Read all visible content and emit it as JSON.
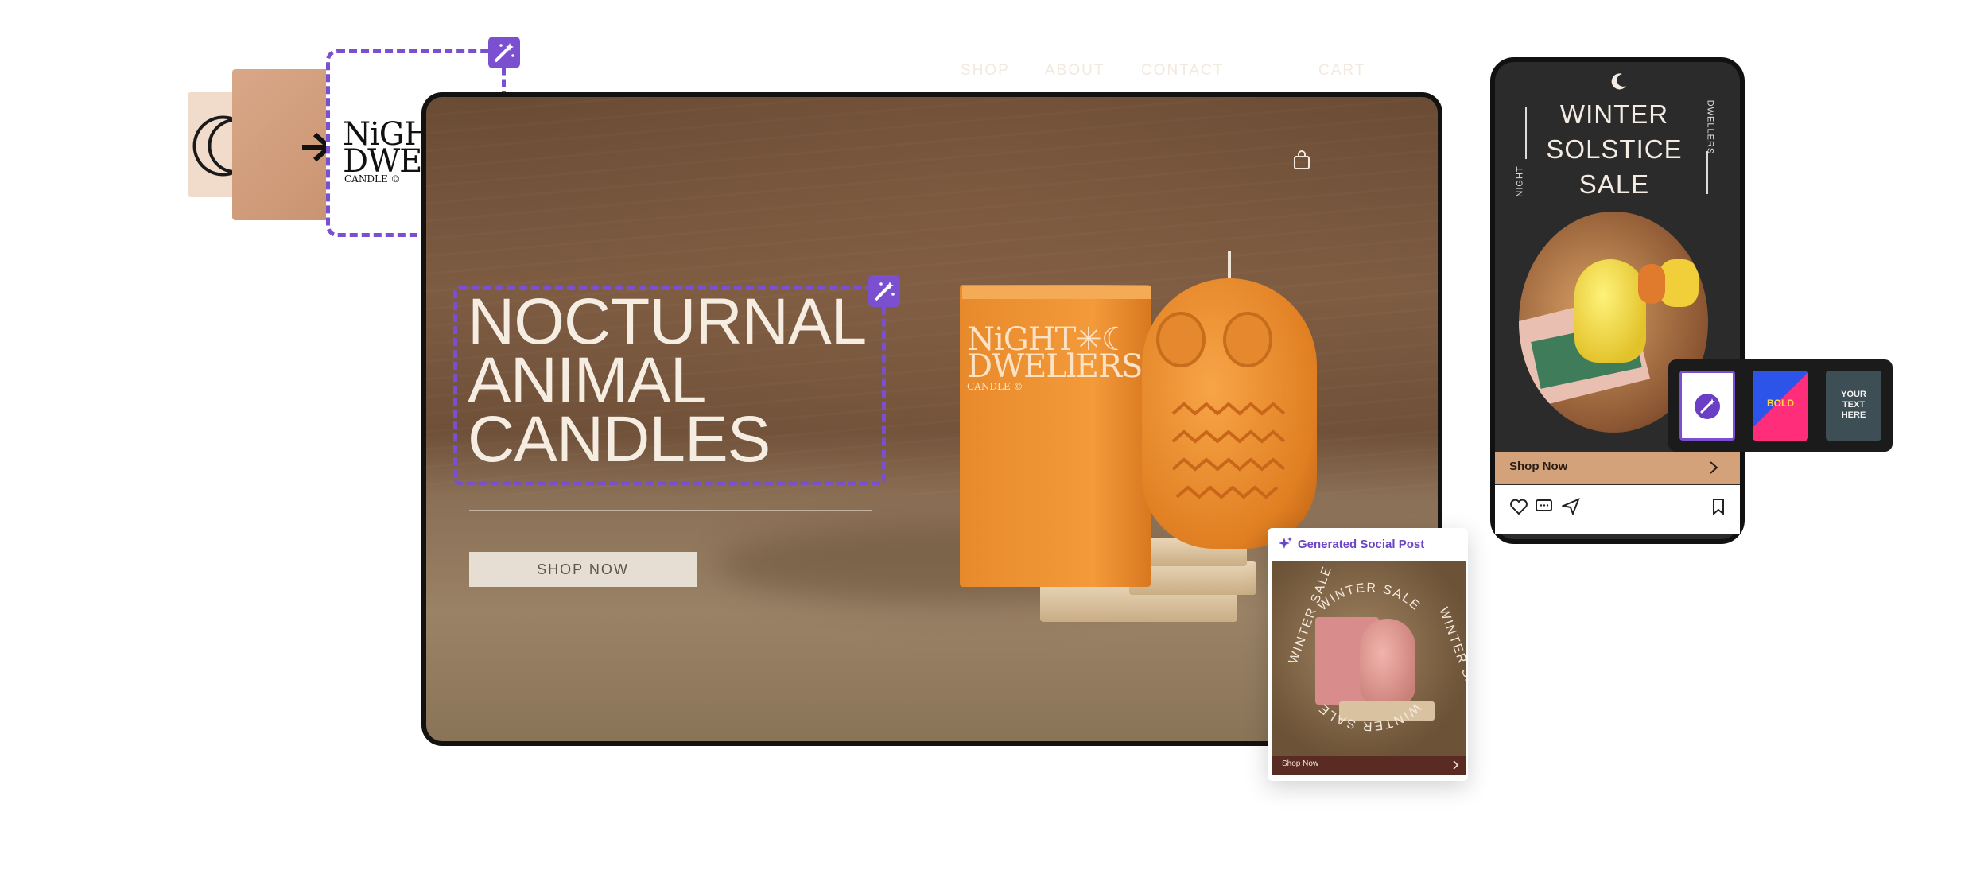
{
  "logo": {
    "line1": "NiGHT✳☾",
    "line2": "DWELlERS",
    "line3": "CANDLE ©"
  },
  "site": {
    "nav": {
      "shop": "SHOP",
      "about": "ABOUT",
      "contact": "CONTACT",
      "cart": "CART"
    },
    "hero": {
      "line1": "NOCTURNAL",
      "line2": "ANIMAL",
      "line3": "CANDLES"
    },
    "cta": "SHOP NOW",
    "box": {
      "line1": "NiGHT✳☾",
      "line2": "DWELlERS",
      "line3": "CANDLE ©"
    }
  },
  "phone": {
    "title": {
      "line1": "WINTER",
      "line2": "SOLSTICE",
      "line3": "SALE"
    },
    "side_left": "NIGHT",
    "side_right": "DWELLERS",
    "cta": "Shop Now",
    "styles": [
      {
        "name": "magic-wand",
        "label": ""
      },
      {
        "name": "bold",
        "label": "BOLD"
      },
      {
        "name": "your-text-here",
        "label": "YOUR TEXT HERE"
      }
    ]
  },
  "social_post": {
    "header": "Generated Social Post",
    "arc_top": "WINTER SALE",
    "arc_left": "WINTER SALE",
    "arc_right": "WINTER SALE",
    "arc_bottom": "WINTER SALE",
    "cta": "Shop Now"
  },
  "colors": {
    "accent_purple": "#7a4fd0",
    "candle_orange": "#f39a3a",
    "phone_cta": "#d4a27a"
  }
}
